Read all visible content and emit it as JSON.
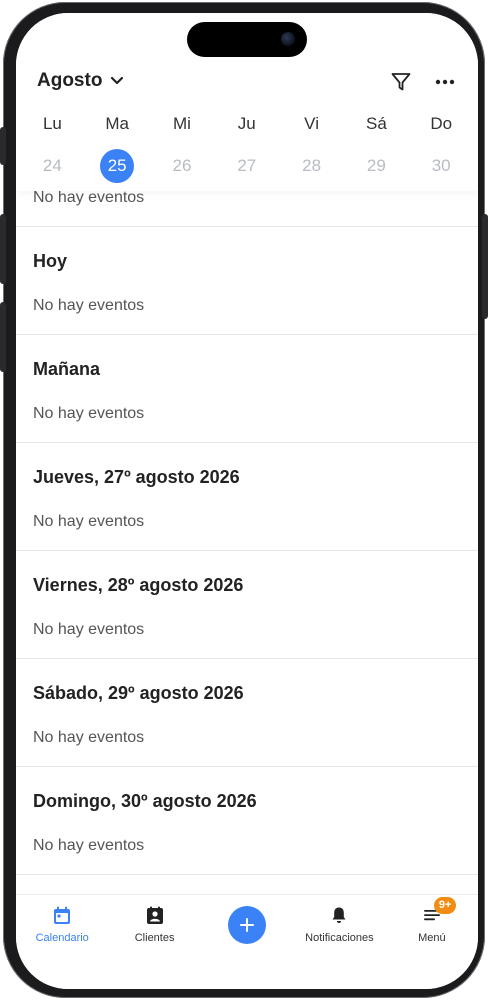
{
  "header": {
    "month": "Agosto",
    "filter_icon": "filter-icon",
    "more_icon": "more-icon"
  },
  "week": {
    "days": [
      {
        "name": "Lu",
        "num": "24",
        "selected": false
      },
      {
        "name": "Ma",
        "num": "25",
        "selected": true
      },
      {
        "name": "Mi",
        "num": "26",
        "selected": false
      },
      {
        "name": "Ju",
        "num": "27",
        "selected": false
      },
      {
        "name": "Vi",
        "num": "28",
        "selected": false
      },
      {
        "name": "Sá",
        "num": "29",
        "selected": false
      },
      {
        "name": "Do",
        "num": "30",
        "selected": false
      }
    ]
  },
  "list": {
    "first_empty": "No hay eventos",
    "sections": [
      {
        "title": "Hoy",
        "empty": "No hay eventos"
      },
      {
        "title": "Mañana",
        "empty": "No hay eventos"
      },
      {
        "title": "Jueves, 27º agosto 2026",
        "empty": "No hay eventos"
      },
      {
        "title": "Viernes, 28º agosto 2026",
        "empty": "No hay eventos"
      },
      {
        "title": "Sábado, 29º agosto 2026",
        "empty": "No hay eventos"
      },
      {
        "title": "Domingo, 30º agosto 2026",
        "empty": "No hay eventos"
      }
    ]
  },
  "nav": {
    "items": [
      {
        "label": "Calendario",
        "icon": "calendar-icon",
        "active": true
      },
      {
        "label": "Clientes",
        "icon": "contacts-icon",
        "active": false
      },
      {
        "label": "",
        "icon": "plus-icon",
        "active": false
      },
      {
        "label": "Notificaciones",
        "icon": "bell-icon",
        "active": false
      },
      {
        "label": "Menú",
        "icon": "menu-icon",
        "active": false,
        "badge": "9+"
      }
    ]
  },
  "colors": {
    "accent": "#3b82f6",
    "badge": "#f28c13",
    "inactive_day": "#b8bcc2"
  }
}
